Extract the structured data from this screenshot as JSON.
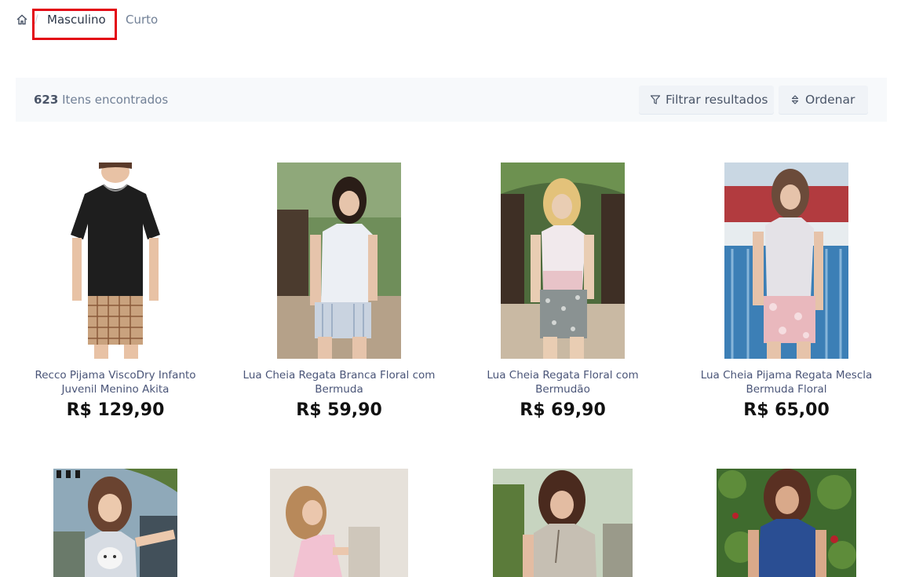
{
  "breadcrumb": {
    "home_icon": "home-icon",
    "items": [
      "Masculino",
      "Curto"
    ],
    "separator": "/"
  },
  "results": {
    "count": "623",
    "count_label": "Itens encontrados",
    "filter_label": "Filtrar resultados",
    "sort_label": "Ordenar",
    "filter_icon": "filter-icon",
    "sort_icon": "sort-icon"
  },
  "products": [
    {
      "name": "Recco Pijama ViscoDry Infanto Juvenil Menino Akita",
      "price": "R$ 129,90"
    },
    {
      "name": "Lua Cheia Regata Branca Floral com Bermuda",
      "price": "R$ 59,90"
    },
    {
      "name": "Lua Cheia Regata Floral com Bermudão",
      "price": "R$ 69,90"
    },
    {
      "name": "Lua Cheia Pijama Regata Mescla Bermuda Floral",
      "price": "R$ 65,00"
    }
  ],
  "colors": {
    "highlight": "#e30613",
    "bar_bg": "#f7f9fb",
    "link": "#4a5578"
  }
}
